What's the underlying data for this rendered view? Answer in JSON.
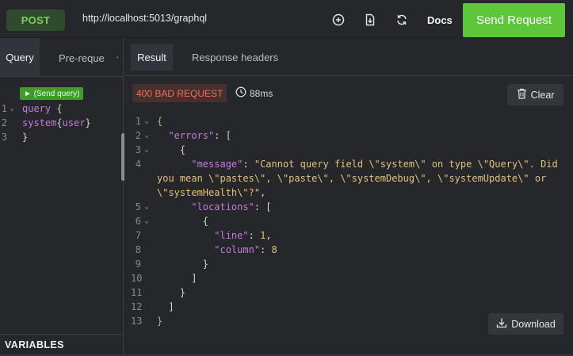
{
  "topbar": {
    "method": "POST",
    "url": "http://localhost:5013/graphql",
    "icons": [
      "plus-circle-icon",
      "file-download-icon",
      "refresh-icon"
    ],
    "docs_label": "Docs",
    "send_label": "Send Request"
  },
  "left": {
    "tabs": [
      {
        "label": "Query"
      },
      {
        "label": "Pre-reque"
      }
    ],
    "tab_more": "·",
    "run_badge": "► (Send query)",
    "lines": [
      {
        "num": "1",
        "fold": "⌄",
        "tokens": [
          {
            "t": "query",
            "c": "kw"
          },
          {
            "t": " {",
            "c": "plain"
          }
        ]
      },
      {
        "num": "2",
        "fold": "",
        "tokens": [
          {
            "t": "system",
            "c": "fld"
          },
          {
            "t": "{",
            "c": "plain"
          },
          {
            "t": "user",
            "c": "fld"
          },
          {
            "t": "}",
            "c": "plain"
          }
        ]
      },
      {
        "num": "3",
        "fold": "",
        "tokens": [
          {
            "t": "}",
            "c": "plain"
          }
        ]
      }
    ],
    "variables_label": "VARIABLES"
  },
  "right": {
    "tabs": [
      {
        "label": "Result"
      },
      {
        "label": "Response headers"
      }
    ],
    "status": "400 BAD REQUEST",
    "time": "88ms",
    "clear_label": "Clear",
    "download_label": "Download",
    "lines": [
      {
        "num": "1",
        "fold": "⌄",
        "tokens": [
          {
            "t": "{",
            "c": "br-g"
          }
        ]
      },
      {
        "num": "2",
        "fold": "⌄",
        "tokens": [
          {
            "t": "  ",
            "c": "plain"
          },
          {
            "t": "\"errors\"",
            "c": "key"
          },
          {
            "t": ": [",
            "c": "plain"
          }
        ]
      },
      {
        "num": "3",
        "fold": "⌄",
        "tokens": [
          {
            "t": "    {",
            "c": "plain"
          }
        ]
      },
      {
        "num": "4",
        "fold": "",
        "tokens": [
          {
            "t": "      ",
            "c": "plain"
          },
          {
            "t": "\"message\"",
            "c": "key"
          },
          {
            "t": ": ",
            "c": "plain"
          },
          {
            "t": "\"Cannot query field \\\"system\\\" on type \\\"Query\\\". Did",
            "c": "str"
          }
        ]
      },
      {
        "num": "",
        "fold": "",
        "tokens": [
          {
            "t": "you mean \\\"pastes\\\", \\\"paste\\\", \\\"systemDebug\\\", \\\"systemUpdate\\\" or",
            "c": "str"
          }
        ]
      },
      {
        "num": "",
        "fold": "",
        "tokens": [
          {
            "t": "\\\"systemHealth\\\"?\"",
            "c": "str"
          },
          {
            "t": ",",
            "c": "plain"
          }
        ]
      },
      {
        "num": "5",
        "fold": "⌄",
        "tokens": [
          {
            "t": "      ",
            "c": "plain"
          },
          {
            "t": "\"locations\"",
            "c": "key"
          },
          {
            "t": ": [",
            "c": "plain"
          }
        ]
      },
      {
        "num": "6",
        "fold": "⌄",
        "tokens": [
          {
            "t": "        {",
            "c": "plain"
          }
        ]
      },
      {
        "num": "7",
        "fold": "",
        "tokens": [
          {
            "t": "          ",
            "c": "plain"
          },
          {
            "t": "\"line\"",
            "c": "key"
          },
          {
            "t": ": ",
            "c": "plain"
          },
          {
            "t": "1",
            "c": "num"
          },
          {
            "t": ",",
            "c": "plain"
          }
        ]
      },
      {
        "num": "8",
        "fold": "",
        "tokens": [
          {
            "t": "          ",
            "c": "plain"
          },
          {
            "t": "\"column\"",
            "c": "key"
          },
          {
            "t": ": ",
            "c": "plain"
          },
          {
            "t": "8",
            "c": "num"
          }
        ]
      },
      {
        "num": "9",
        "fold": "",
        "tokens": [
          {
            "t": "        }",
            "c": "plain"
          }
        ]
      },
      {
        "num": "10",
        "fold": "",
        "tokens": [
          {
            "t": "      ]",
            "c": "plain"
          }
        ]
      },
      {
        "num": "11",
        "fold": "",
        "tokens": [
          {
            "t": "    }",
            "c": "plain"
          }
        ]
      },
      {
        "num": "12",
        "fold": "",
        "tokens": [
          {
            "t": "  ]",
            "c": "plain"
          }
        ]
      },
      {
        "num": "13",
        "fold": "",
        "tokens": [
          {
            "t": "}",
            "c": "br-g"
          }
        ]
      }
    ]
  },
  "colors": {
    "accent": "#5dc63a",
    "method_text": "#7fce5a",
    "error": "#f26b5b",
    "key": "#c678dd",
    "string": "#e5c07b"
  }
}
